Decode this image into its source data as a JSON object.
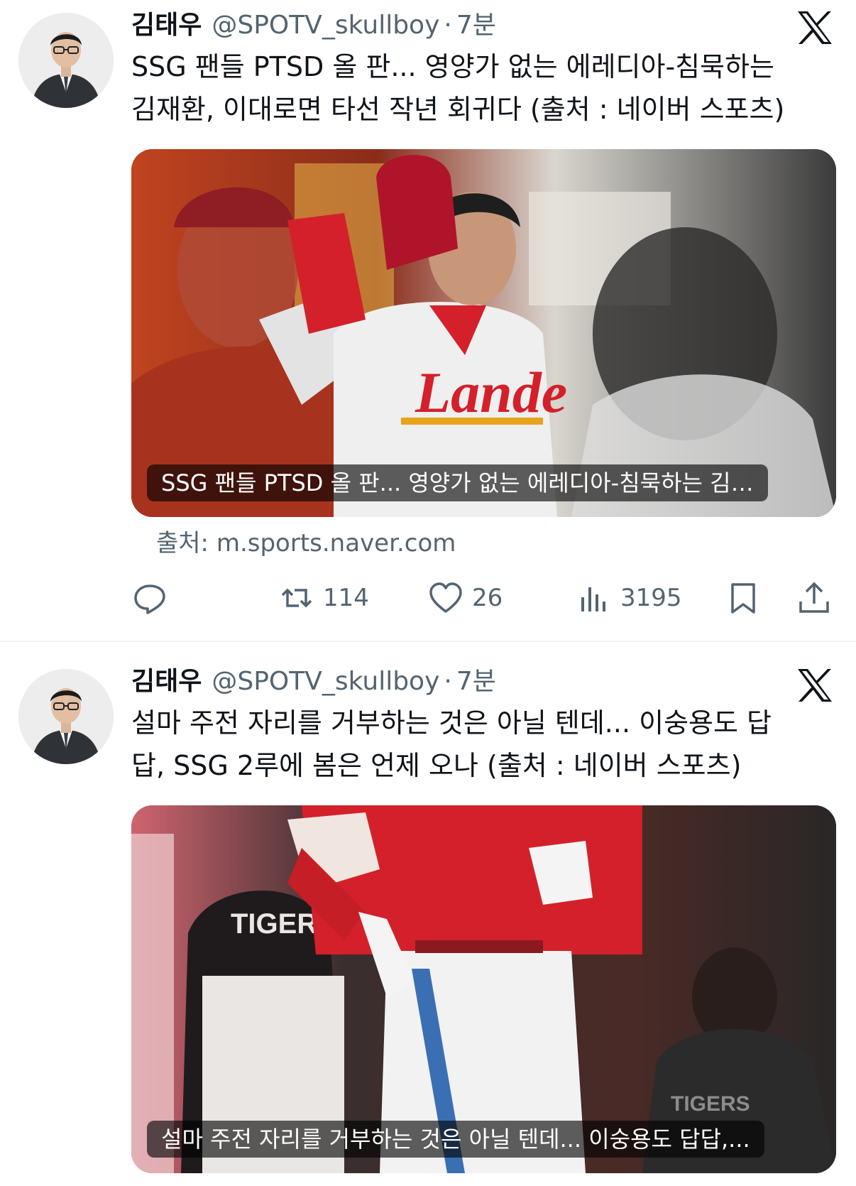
{
  "tweets": [
    {
      "author_name": "김태우",
      "handle": "@SPOTV_skullboy",
      "separator": "·",
      "time": "7분",
      "text_line1": "SSG 팬들 PTSD 올 판... 영양가 없는 에레디아-침묵하는",
      "text_line2": "김재환, 이대로면 타선 작년 회귀다 (출처 : 네이버 스포츠)",
      "card_caption": "SSG 팬들 PTSD 올 판... 영양가 없는 에레디아-침묵하는 김…",
      "source": "출처: m.sports.naver.com",
      "retweets": "114",
      "likes": "26",
      "views": "3195"
    },
    {
      "author_name": "김태우",
      "handle": "@SPOTV_skullboy",
      "separator": "·",
      "time": "7분",
      "text_line1": "설마 주전 자리를 거부하는 것은 아닐 텐데... 이숭용도 답",
      "text_line2": "답, SSG 2루에 봄은 언제 오나 (출처 : 네이버 스포츠)",
      "card_caption": "설마 주전 자리를 거부하는 것은 아닐 텐데... 이숭용도 답답,..."
    }
  ],
  "icons": {
    "logo": "x-logo-icon",
    "reply": "reply-icon",
    "retweet": "retweet-icon",
    "like": "heart-icon",
    "views": "views-chart-icon",
    "bookmark": "bookmark-icon",
    "share": "share-icon"
  },
  "colors": {
    "text_primary": "#0f1419",
    "text_secondary": "#536471",
    "divider": "#eff3f4",
    "jersey_red": "#d4202a"
  }
}
